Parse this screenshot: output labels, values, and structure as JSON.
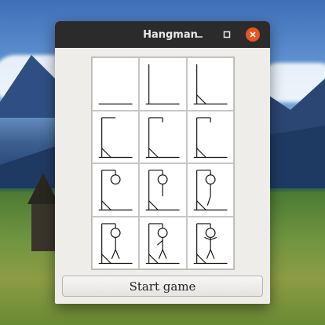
{
  "window": {
    "title": "Hangman"
  },
  "controls": {
    "minimize_icon": "minimize-icon",
    "maximize_icon": "maximize-icon",
    "close_icon": "close-icon"
  },
  "hangman_stages": [
    {
      "stage": 1,
      "parts": [
        "ground"
      ]
    },
    {
      "stage": 2,
      "parts": [
        "ground",
        "pole"
      ]
    },
    {
      "stage": 3,
      "parts": [
        "ground",
        "pole",
        "brace"
      ]
    },
    {
      "stage": 4,
      "parts": [
        "ground",
        "pole",
        "brace",
        "beam"
      ]
    },
    {
      "stage": 5,
      "parts": [
        "ground",
        "pole",
        "brace",
        "beam",
        "rope"
      ]
    },
    {
      "stage": 6,
      "parts": [
        "ground",
        "pole",
        "brace",
        "beam",
        "rope"
      ]
    },
    {
      "stage": 7,
      "parts": [
        "ground",
        "pole",
        "brace",
        "beam",
        "rope",
        "head"
      ]
    },
    {
      "stage": 8,
      "parts": [
        "ground",
        "pole",
        "brace",
        "beam",
        "rope",
        "head",
        "body"
      ]
    },
    {
      "stage": 9,
      "parts": [
        "ground",
        "pole",
        "brace",
        "beam",
        "rope",
        "head",
        "body",
        "leg-left"
      ]
    },
    {
      "stage": 10,
      "parts": [
        "ground",
        "pole",
        "brace",
        "beam",
        "rope",
        "head",
        "body",
        "legs"
      ]
    },
    {
      "stage": 11,
      "parts": [
        "ground",
        "pole",
        "brace",
        "beam",
        "rope",
        "head",
        "body",
        "legs",
        "arm-left"
      ]
    },
    {
      "stage": 12,
      "parts": [
        "ground",
        "pole",
        "brace",
        "beam",
        "rope",
        "head",
        "body",
        "legs",
        "arms"
      ]
    }
  ],
  "start_button": {
    "label": "Start game"
  }
}
